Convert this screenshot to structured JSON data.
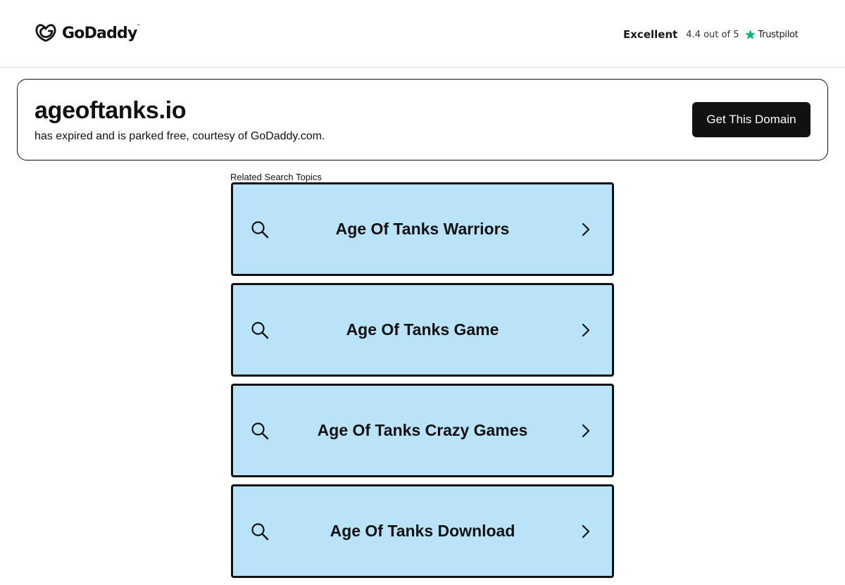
{
  "header": {
    "logo_text": "GoDaddy",
    "logo_tm": "™",
    "logo_icon": "godaddy-logo-icon",
    "trustpilot": {
      "rating_word": "Excellent",
      "score_text": "4.4 out of 5",
      "brand": "Trustpilot",
      "star_icon": "star-icon",
      "star_color": "#00b67a"
    }
  },
  "domain": {
    "name": "ageoftanks.io",
    "note": "has expired and is parked free, courtesy of GoDaddy.com.",
    "button_label": "Get This Domain"
  },
  "related": {
    "label": "Related Search Topics",
    "background_color": "#b9e3f8",
    "items": [
      {
        "label": "Age Of Tanks Warriors",
        "icon": "search-icon",
        "trailing_icon": "chevron-right-icon"
      },
      {
        "label": "Age Of Tanks Game",
        "icon": "search-icon",
        "trailing_icon": "chevron-right-icon"
      },
      {
        "label": "Age Of Tanks Crazy Games",
        "icon": "search-icon",
        "trailing_icon": "chevron-right-icon"
      },
      {
        "label": "Age Of Tanks Download",
        "icon": "search-icon",
        "trailing_icon": "chevron-right-icon"
      }
    ]
  }
}
